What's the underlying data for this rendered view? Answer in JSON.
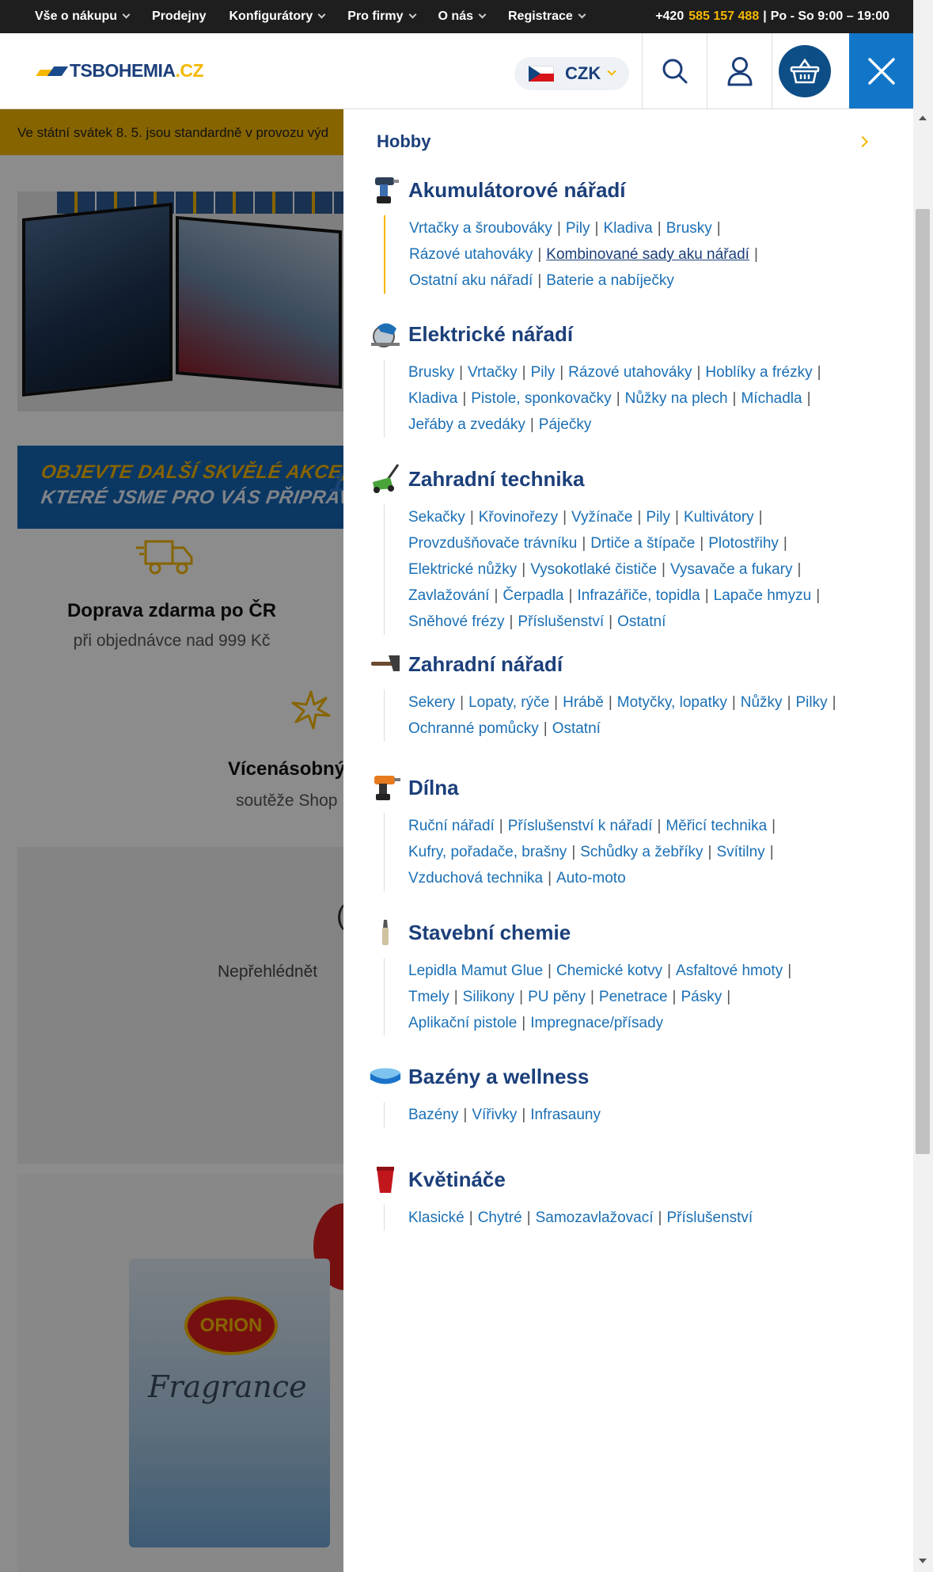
{
  "topbar": {
    "nav": [
      {
        "label": "Vše o nákupu",
        "dropdown": true
      },
      {
        "label": "Prodejny",
        "dropdown": false
      },
      {
        "label": "Konfigurátory",
        "dropdown": true
      },
      {
        "label": "Pro firmy",
        "dropdown": true
      },
      {
        "label": "O nás",
        "dropdown": true
      },
      {
        "label": "Registrace",
        "dropdown": true
      }
    ],
    "phone_prefix": "+420",
    "phone": "585 157 488",
    "separator": "|",
    "hours": "Po - So 9:00 – 19:00"
  },
  "header": {
    "logo_main": "TSBOHEMIA",
    "logo_suffix": ".CZ",
    "currency": "CZK",
    "icons": {
      "search": "search-icon",
      "user": "user-icon",
      "cart": "basket-icon",
      "close": "close-icon"
    }
  },
  "background_page": {
    "notice": "Ve státní svátek 8. 5. jsou standardně v provozu výd",
    "promo_line1": "OBJEVTE DALŠÍ SKVĚLÉ AKCE,",
    "promo_line2": "KTERÉ JSME PRO VÁS PŘIPRAVILI",
    "promo_cut": "1",
    "benefit1_title": "Doprava zdarma po ČR",
    "benefit1_sub": "při objednávce nad 999 Kč",
    "benefit2_title": "Vícenásobný",
    "benefit2_sub": "soutěže Shop",
    "grey_text": "Nepřehlédnět",
    "paren": "(",
    "product_brand": "ORION",
    "product_script": "Fragrance"
  },
  "menu": {
    "title": "Hobby",
    "categories": [
      {
        "title": "Akumulátorové nářadí",
        "icon": "cordless-drill-icon",
        "active": true,
        "lines": [
          [
            "Vrtačky a šroubováky",
            "Pily",
            "Kladiva",
            "Brusky"
          ],
          [
            "Rázové utahováky",
            "Kombinované sady aku nářadí"
          ],
          [
            "Ostatní aku nářadí",
            "Baterie a nabíječky"
          ]
        ],
        "highlight": "Kombinované sady aku nářadí"
      },
      {
        "title": "Elektrické nářadí",
        "icon": "circular-saw-icon",
        "lines": [
          [
            "Brusky",
            "Vrtačky",
            "Pily",
            "Rázové utahováky",
            "Hoblíky a frézky"
          ],
          [
            "Kladiva",
            "Pistole, sponkovačky",
            "Nůžky na plech",
            "Míchadla"
          ],
          [
            "Jeřáby a zvedáky",
            "Páječky"
          ]
        ]
      },
      {
        "title": "Zahradní technika",
        "icon": "lawn-mower-icon",
        "lines": [
          [
            "Sekačky",
            "Křovinořezy",
            "Vyžínače",
            "Pily",
            "Kultivátory"
          ],
          [
            "Provzdušňovače trávníku",
            "Drtiče a štípače",
            "Plotostřihy"
          ],
          [
            "Elektrické nůžky",
            "Vysokotlaké čističe",
            "Vysavače a fukary"
          ],
          [
            "Zavlažování",
            "Čerpadla",
            "Infrazářiče, topidla",
            "Lapače hmyzu"
          ],
          [
            "Sněhové frézy",
            "Příslušenství",
            "Ostatní"
          ]
        ]
      },
      {
        "title": "Zahradní nářadí",
        "icon": "axe-icon",
        "lines": [
          [
            "Sekery",
            "Lopaty, rýče",
            "Hrábě",
            "Motyčky, lopatky",
            "Nůžky",
            "Pilky"
          ],
          [
            "Ochranné pomůcky",
            "Ostatní"
          ]
        ]
      },
      {
        "title": "Dílna",
        "icon": "drill-icon",
        "lines": [
          [
            "Ruční nářadí",
            "Příslušenství k nářadí",
            "Měřicí technika"
          ],
          [
            "Kufry, pořadače, brašny",
            "Schůdky a žebříky",
            "Svítilny"
          ],
          [
            "Vzduchová technika",
            "Auto-moto"
          ]
        ]
      },
      {
        "title": "Stavební chemie",
        "icon": "sealant-tube-icon",
        "lines": [
          [
            "Lepidla Mamut Glue",
            "Chemické kotvy",
            "Asfaltové hmoty"
          ],
          [
            "Tmely",
            "Silikony",
            "PU pěny",
            "Penetrace",
            "Pásky"
          ],
          [
            "Aplikační pistole",
            "Impregnace/přísady"
          ]
        ]
      },
      {
        "title": "Bazény a wellness",
        "icon": "pool-icon",
        "lines": [
          [
            "Bazény",
            "Vířivky",
            "Infrasauny"
          ]
        ]
      },
      {
        "title": "Květináče",
        "icon": "flower-pot-icon",
        "lines": [
          [
            "Klasické",
            "Chytré",
            "Samozavlažovací",
            "Příslušenství"
          ]
        ]
      }
    ]
  },
  "colors": {
    "topbar_bg": "#1e1e1e",
    "accent_yellow": "#f5b700",
    "brand_blue": "#1b3f7a",
    "link_blue": "#1a6fb5",
    "close_bg": "#1176c8",
    "cart_bg": "#0d4e87"
  }
}
